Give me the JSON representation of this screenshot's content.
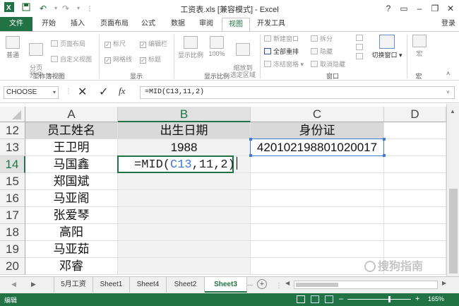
{
  "window": {
    "title": "工资表.xls  [兼容模式] - Excel",
    "help": "?",
    "minimize": "–",
    "restore": "❐",
    "close": "✕",
    "login": "登录"
  },
  "quick_access": [
    "save-icon",
    "undo-icon",
    "redo-icon"
  ],
  "tabs": {
    "file": "文件",
    "home": "开始",
    "insert": "插入",
    "page_layout": "页面布局",
    "formulas": "公式",
    "data": "数据",
    "review": "审阅",
    "view": "视图",
    "developer": "开发工具"
  },
  "ribbon": {
    "workbook_views": {
      "label": "工作簿视图",
      "normal": "普通",
      "page_break": "分页\n预览",
      "page_layout": "页面布局",
      "custom_views": "自定义视图"
    },
    "show": {
      "label": "显示",
      "ruler": "标尺",
      "formula_bar": "编辑栏",
      "gridlines": "网格线",
      "headings": "标题"
    },
    "zoom": {
      "label": "显示比例",
      "zoom": "显示比例",
      "zoom100": "100%",
      "zoom_selection": "缩放到\n选定区域"
    },
    "window": {
      "label": "窗口",
      "new_window": "新建窗口",
      "arrange_all": "全部重排",
      "freeze_panes": "冻结窗格",
      "split": "拆分",
      "hide": "隐藏",
      "unhide": "取消隐藏",
      "switch_windows": "切换窗口"
    },
    "macros": {
      "label": "宏",
      "macros": "宏"
    }
  },
  "formula_bar": {
    "name_box": "CHOOSE",
    "cancel": "✕",
    "enter": "✓",
    "fx": "fx",
    "content": "=MID(C13,11,2)"
  },
  "grid": {
    "columns": [
      "A",
      "B",
      "C",
      "D"
    ],
    "rows": [
      {
        "n": "12",
        "A": "员工姓名",
        "B": "出生日期",
        "C": "身份证"
      },
      {
        "n": "13",
        "A": "王卫明",
        "B": "1988",
        "C": "420102198801020017"
      },
      {
        "n": "14",
        "A": "马国鑫",
        "B": "",
        "C": ""
      },
      {
        "n": "15",
        "A": "郑国斌",
        "B": "",
        "C": ""
      },
      {
        "n": "16",
        "A": "马亚阁",
        "B": "",
        "C": ""
      },
      {
        "n": "17",
        "A": "张爱琴",
        "B": "",
        "C": ""
      },
      {
        "n": "18",
        "A": "高阳",
        "B": "",
        "C": ""
      },
      {
        "n": "19",
        "A": "马亚茹",
        "B": "",
        "C": ""
      },
      {
        "n": "20",
        "A": "邓睿",
        "B": "",
        "C": ""
      }
    ],
    "editing_cell": {
      "prefix": "=MID(",
      "ref": "C13",
      "suffix": ",11,2)"
    },
    "colors": {
      "ref": "#3e7bd6",
      "accent": "#217346"
    }
  },
  "sheets": [
    "5月工资",
    "Sheet1",
    "Sheet4",
    "Sheet2",
    "Sheet3"
  ],
  "sheet_more": "...",
  "add_sheet": "+",
  "status": {
    "mode": "编辑",
    "zoom": "165%"
  },
  "watermark": "搜狗指南"
}
